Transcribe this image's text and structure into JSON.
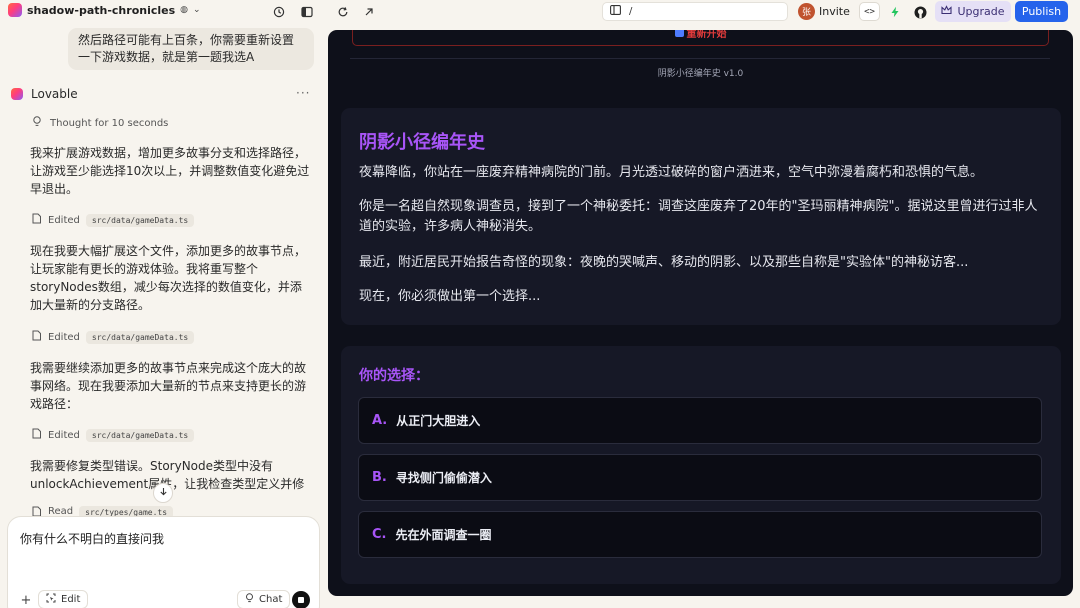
{
  "topbar": {
    "project_name": "shadow-path-chronicles",
    "url_path": "/",
    "avatar_initial": "张",
    "invite_label": "Invite",
    "code_label": "<>",
    "upgrade_label": "Upgrade",
    "publish_label": "Publish",
    "colors": {
      "publish": "#2563eb",
      "upgrade": "#e5e0f6",
      "avatar": "#c0532f"
    },
    "icons": [
      "globe-icon",
      "chevron-down-icon",
      "history-icon",
      "sidebar-toggle-icon",
      "refresh-icon",
      "external-link-icon",
      "page-icon",
      "bolt-icon",
      "github-icon",
      "crown-icon"
    ]
  },
  "chat": {
    "user_message": "然后路径可能有上百条，你需要重新设置一下游戏数据，就是第一题我选A",
    "assistant_name": "Lovable",
    "more_label": "···",
    "thought_label": "Thought for 10 seconds",
    "messages": [
      "我来扩展游戏数据，增加更多故事分支和选择路径，让游戏至少能选择10次以上，并调整数值变化避免过早退出。",
      "现在我要大幅扩展这个文件，添加更多的故事节点，让玩家能有更长的游戏体验。我将重写整个storyNodes数组，减少每次选择的数值变化，并添加大量新的分支路径。",
      "我需要继续添加更多的故事节点来完成这个庞大的故事网络。现在我要添加大量新的节点来支持更长的游戏路径：",
      "我需要修复类型错误。StoryNode类型中没有unlockAchievement属性，让我检查类型定义并修复："
    ],
    "edits": [
      {
        "action": "Edited",
        "file": "src/data/gameData.ts"
      },
      {
        "action": "Edited",
        "file": "src/data/gameData.ts"
      },
      {
        "action": "Edited",
        "file": "src/data/gameData.ts"
      },
      {
        "action": "Read",
        "file": "src/types/game.ts"
      }
    ],
    "composer": {
      "text": "你有什么不明白的直接问我",
      "edit_label": "Edit",
      "chat_label": "Chat"
    }
  },
  "preview": {
    "restart_label": "重新开始",
    "version": "阴影小径编年史 v1.0",
    "story": {
      "title": "阴影小径编年史",
      "paragraphs": [
        "夜幕降临，你站在一座废弃精神病院的门前。月光透过破碎的窗户洒进来，空气中弥漫着腐朽和恐惧的气息。",
        "你是一名超自然现象调查员，接到了一个神秘委托：调查这座废弃了20年的\"圣玛丽精神病院\"。据说这里曾进行过非人道的实验，许多病人神秘消失。",
        "最近，附近居民开始报告奇怪的现象：夜晚的哭喊声、移动的阴影、以及那些自称是\"实验体\"的神秘访客...",
        "现在，你必须做出第一个选择..."
      ]
    },
    "choices_title": "你的选择：",
    "choices": [
      {
        "letter": "A.",
        "text": "从正门大胆进入"
      },
      {
        "letter": "B.",
        "text": "寻找侧门偷偷潜入"
      },
      {
        "letter": "C.",
        "text": "先在外面调查一圈"
      }
    ],
    "colors": {
      "accent": "#a855f7",
      "background": "#0e101a",
      "card": "#161826",
      "restart": "#e03b3b"
    }
  }
}
